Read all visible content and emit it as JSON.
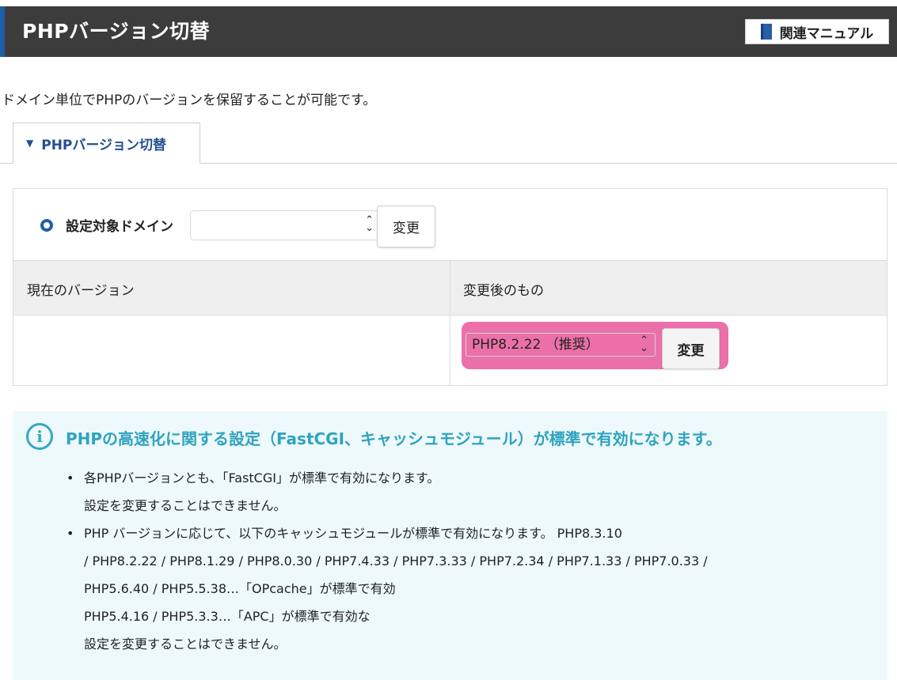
{
  "header": {
    "title": "PHPバージョン切替",
    "manual_button": "関連マニュアル"
  },
  "intro": "ドメイン単位でPHPのバージョンを保留することが可能です。",
  "tab": {
    "label": "PHPバージョン切替"
  },
  "domain_row": {
    "label": "設定対象ドメイン",
    "select_value": "",
    "change_button": "変更"
  },
  "table": {
    "col_current": "現在のバージョン",
    "col_new": "変更後のもの",
    "current_value": "",
    "new_select_value": "PHP8.2.22 （推奨）",
    "change_button": "変更"
  },
  "info": {
    "title": "PHPの高速化に関する設定（FastCGI、キャッシュモジュール）が標準で有効になります。",
    "items": [
      {
        "lines": [
          "各PHPバージョンとも、「FastCGI」が標準で有効になります。",
          "設定を変更することはできません。"
        ]
      },
      {
        "lines": [
          "PHP バージョンに応じて、以下のキャッシュモジュールが標準で有効になります。 PHP8.3.10",
          "/ PHP8.2.22 / PHP8.1.29 / PHP8.0.30 / PHP7.4.33 / PHP7.3.33 / PHP7.2.34 / PHP7.1.33 / PHP7.0.33 /",
          "PHP5.6.40 / PHP5.5.38…「OPcache」が標準で有効",
          "PHP5.4.16 / PHP5.3.3…「APC」が標準で有効な",
          "設定を変更することはできません。"
        ]
      }
    ]
  },
  "colors": {
    "header_bg": "#3c3c3c",
    "accent_blue": "#1f5ea8",
    "highlight_pink": "#e7579a",
    "info_teal": "#2fa3bf",
    "info_bg": "#eef9fb"
  }
}
